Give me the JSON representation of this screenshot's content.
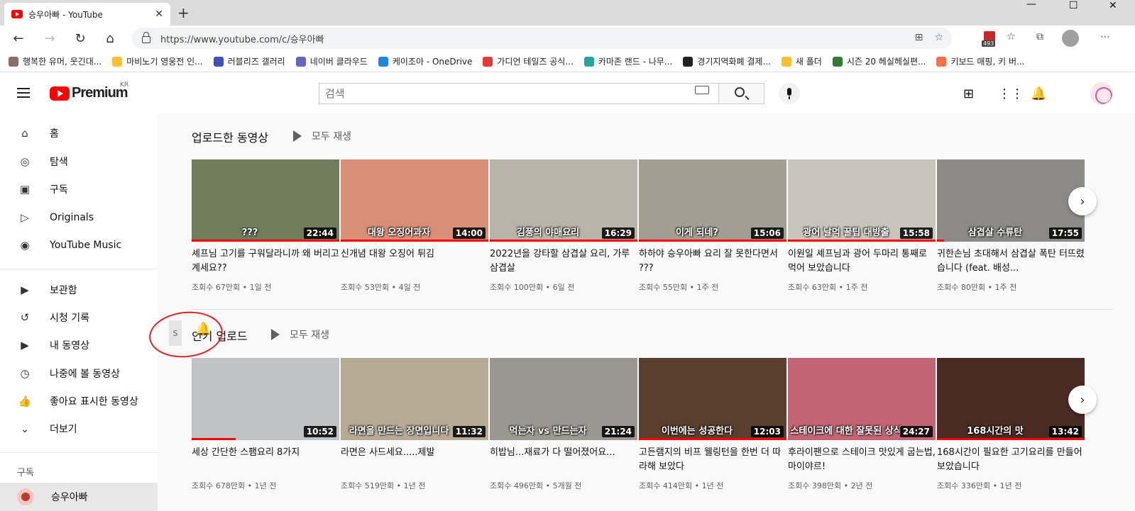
{
  "browser": {
    "tab_title": "승우아빠 - YouTube",
    "url": "https://www.youtube.com/c/승우아빠",
    "extension_badge": "493",
    "bookmarks": [
      {
        "label": "행복한 유머, 웃긴대...",
        "color": "#8d6e63"
      },
      {
        "label": "마비노기 영웅전 인...",
        "color": "#fbc02d"
      },
      {
        "label": "러블리즈 갤러리",
        "color": "#3f51b5"
      },
      {
        "label": "네이버 클라우드",
        "color": "#5c6bc0"
      },
      {
        "label": "케이조아 - OneDrive",
        "color": "#1e88e5"
      },
      {
        "label": "가디언 테일즈 공식...",
        "color": "#e53935"
      },
      {
        "label": "카마존 랜드 - 나무...",
        "color": "#26a69a"
      },
      {
        "label": "경기지역화폐 결제...",
        "color": "#212121"
      },
      {
        "label": "새 폴더",
        "color": "#fbc02d"
      },
      {
        "label": "시즌 20 헤실헤실편...",
        "color": "#2e7d32"
      },
      {
        "label": "키보드 매핑, 키 버...",
        "color": "#ff7043"
      }
    ]
  },
  "header": {
    "logo_text": "Premium",
    "region": "KR",
    "search_placeholder": "검색"
  },
  "sidebar": {
    "items": [
      {
        "label": "홈",
        "icon": "home-icon",
        "glyph": "⌂"
      },
      {
        "label": "탐색",
        "icon": "compass-icon",
        "glyph": "◎"
      },
      {
        "label": "구독",
        "icon": "subscriptions-icon",
        "glyph": "▣"
      },
      {
        "label": "Originals",
        "icon": "originals-icon",
        "glyph": "▷"
      },
      {
        "label": "YouTube Music",
        "icon": "music-icon",
        "glyph": "◉"
      }
    ],
    "library": [
      {
        "label": "보관함",
        "icon": "library-icon",
        "glyph": "▶"
      },
      {
        "label": "시청 기록",
        "icon": "history-icon",
        "glyph": "↺"
      },
      {
        "label": "내 동영상",
        "icon": "my-videos-icon",
        "glyph": "▶"
      },
      {
        "label": "나중에 볼 동영상",
        "icon": "watch-later-icon",
        "glyph": "◷"
      },
      {
        "label": "좋아요 표시한 동영상",
        "icon": "thumbs-up-icon",
        "glyph": "👍"
      },
      {
        "label": "더보기",
        "icon": "chevron-down-icon",
        "glyph": "⌄"
      }
    ],
    "subs_heading": "구독",
    "subscription": "승우아빠"
  },
  "shelves": [
    {
      "title": "업로드한 동영상",
      "play_all": "모두 재생",
      "videos": [
        {
          "title": "셰프님 고기를 구워달라니까 왜 버리고 계세요??",
          "meta": "조회수 67만회 • 1일 전",
          "duration": "22:44",
          "caption": "???",
          "progress": 1.0,
          "bg": "#6f7d5a"
        },
        {
          "title": "신개념 대왕 오징어 튀김",
          "meta": "조회수 53만회 • 4일 전",
          "duration": "14:00",
          "caption": "대왕 오징어과자",
          "progress": 1.0,
          "bg": "#d98f76"
        },
        {
          "title": "2022년을 강타할 삼겹살 요리, 가루삼겹살",
          "meta": "조회수 100만회 • 6일 전",
          "duration": "16:29",
          "caption": "김풍의 야매요리",
          "progress": 1.0,
          "bg": "#b8b4aa"
        },
        {
          "title": "하하야 승우아빠 요리 잘 못한다면서 ???",
          "meta": "조회수 55만회 • 1주 전",
          "duration": "15:06",
          "caption": "이게 되네?",
          "progress": 1.0,
          "bg": "#a39e92"
        },
        {
          "title": "이원일 셰프님과 광어 두마리 통째로 먹어 보았습니다",
          "meta": "조회수 63만회 • 1주 전",
          "duration": "15:58",
          "caption": "광어 날먹 꿀팁 대방출",
          "progress": 1.0,
          "bg": "#c9c5bd"
        },
        {
          "title": "귀한손님 초대해서 삼겹살 폭탄 터뜨렸습니다 (feat. 배성...",
          "meta": "조회수 80만회 • 1주 전",
          "duration": "17:55",
          "caption": "삼겹살 수류탄",
          "progress": 0.05,
          "bg": "#8c8a86"
        }
      ]
    },
    {
      "title": "인기 업로드",
      "play_all": "모두 재생",
      "videos": [
        {
          "title": "세상 간단한 스팸요리 8가지",
          "meta": "조회수 678만회 • 1년 전",
          "duration": "10:52",
          "caption": "",
          "progress": 0.3,
          "bg": "#bfc3c6"
        },
        {
          "title": "라면은 사드세요.....제발",
          "meta": "조회수 519만회 • 1년 전",
          "duration": "11:32",
          "caption": "라면을 만드는 장면입니다",
          "progress": 0.0,
          "bg": "#b7aa95"
        },
        {
          "title": "히밥님...재료가 다 떨어졌어요...",
          "meta": "조회수 496만회 • 5개월 전",
          "duration": "21:24",
          "caption": "먹는자 vs 만드는자",
          "progress": 0.0,
          "bg": "#9a9690"
        },
        {
          "title": "고든램지의 비프 웰링턴을 한번 더 따라해 보았다",
          "meta": "조회수 414만회 • 1년 전",
          "duration": "12:03",
          "caption": "이번에는 성공한다",
          "progress": 1.0,
          "bg": "#5a3f2e"
        },
        {
          "title": "후라이팬으로 스테이크 맛있게 굽는법, 마이야르!",
          "meta": "조회수 398만회 • 2년 전",
          "duration": "24:27",
          "caption": "스테이크에 대한 잘못된 상식",
          "progress": 0.0,
          "bg": "#c26473"
        },
        {
          "title": "168시간이 필요한 고기요리를 만들어 보았습니다",
          "meta": "조회수 336만회 • 1년 전",
          "duration": "13:42",
          "caption": "168시간의 맛",
          "progress": 1.0,
          "bg": "#4a2a22"
        }
      ]
    }
  ],
  "annotation": {
    "side_tab_text": "S"
  },
  "colors": {
    "accent": "#ff0000",
    "annotation": "#e52020"
  }
}
